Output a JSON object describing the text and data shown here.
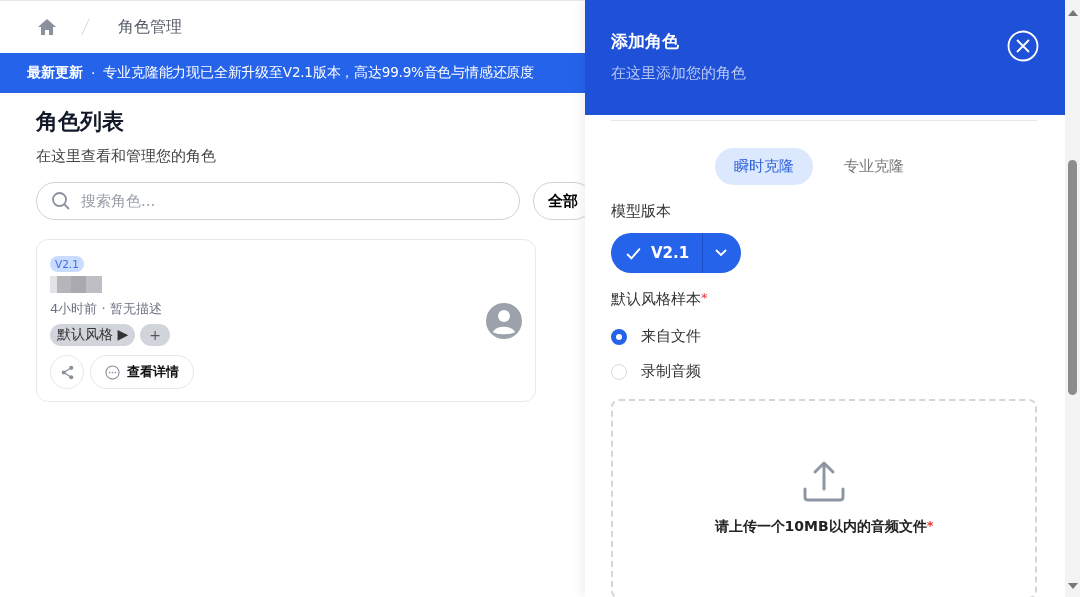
{
  "breadcrumb": {
    "current": "角色管理"
  },
  "banner": {
    "title": "最新更新",
    "separator": "·",
    "message": "专业克隆能力现已全新升级至V2.1版本，高达99.9%音色与情感还原度"
  },
  "page": {
    "title": "角色列表",
    "subtitle": "在这里查看和管理您的角色"
  },
  "search": {
    "placeholder": "搜索角色..."
  },
  "filter": {
    "label": "全部"
  },
  "cards": [
    {
      "version": "V2.1",
      "meta": "4小时前 · 暂无描述",
      "styles": [
        {
          "label": "默认风格",
          "icon": "▶"
        }
      ],
      "add_style": "+",
      "details": "查看详情"
    }
  ],
  "drawer": {
    "title": "添加角色",
    "subtitle": "在这里添加您的角色",
    "tabs": [
      {
        "label": "瞬时克隆",
        "selected": true
      },
      {
        "label": "专业克隆",
        "selected": false
      }
    ],
    "model_label": "模型版本",
    "model_value": "V2.1",
    "style_label": "默认风格样本",
    "required_mark": "*",
    "sources": [
      {
        "label": "来自文件",
        "selected": true
      },
      {
        "label": "录制音频",
        "selected": false
      }
    ],
    "upload": {
      "text": "请上传一个10MB以内的音频文件",
      "required_mark": "*"
    }
  }
}
